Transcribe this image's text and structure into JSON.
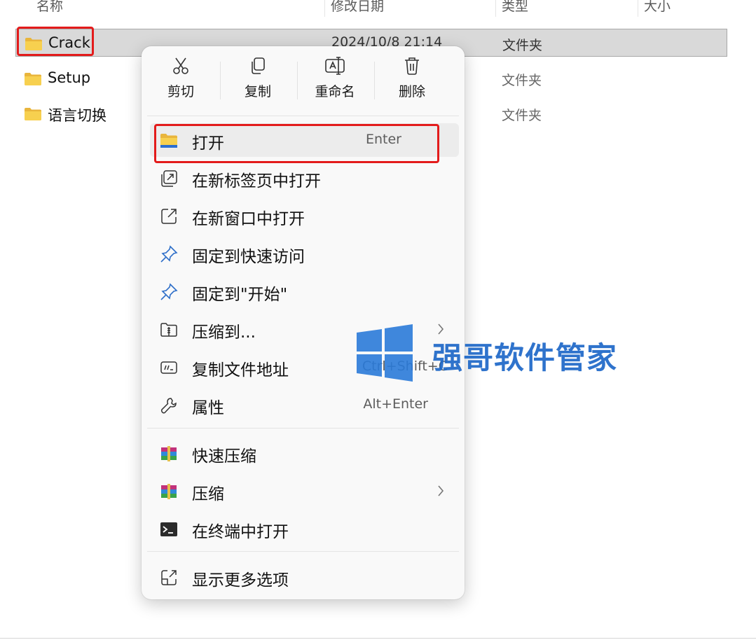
{
  "columns": {
    "name": "名称",
    "modified": "修改日期",
    "type": "类型",
    "size": "大小"
  },
  "files": [
    {
      "name": "Crack",
      "modified": "2024/10/8 21:14",
      "type": "文件夹",
      "selected": true
    },
    {
      "name": "Setup",
      "modified": "",
      "type": "文件夹",
      "selected": false
    },
    {
      "name": "语言切换",
      "modified": "",
      "type": "文件夹",
      "selected": false
    }
  ],
  "context_menu": {
    "quick_actions": [
      {
        "label": "剪切",
        "icon": "scissors-icon"
      },
      {
        "label": "复制",
        "icon": "copy-icon"
      },
      {
        "label": "重命名",
        "icon": "rename-icon"
      },
      {
        "label": "删除",
        "icon": "trash-icon"
      }
    ],
    "items": [
      {
        "label": "打开",
        "shortcut": "Enter",
        "icon": "folder-open-icon"
      },
      {
        "label": "在新标签页中打开",
        "shortcut": "",
        "icon": "new-tab-icon"
      },
      {
        "label": "在新窗口中打开",
        "shortcut": "",
        "icon": "new-window-icon"
      },
      {
        "label": "固定到快速访问",
        "shortcut": "",
        "icon": "pin-icon"
      },
      {
        "label": "固定到\"开始\"",
        "shortcut": "",
        "icon": "pin-icon"
      },
      {
        "label": "压缩到...",
        "shortcut": "",
        "icon": "zip-folder-icon",
        "submenu": true
      },
      {
        "label": "复制文件地址",
        "shortcut": "Ctrl+Shift+C",
        "icon": "copy-path-icon"
      },
      {
        "label": "属性",
        "shortcut": "Alt+Enter",
        "icon": "wrench-icon"
      }
    ],
    "extra_items": [
      {
        "label": "快速压缩",
        "icon": "winrar-icon"
      },
      {
        "label": "压缩",
        "icon": "winrar-icon",
        "submenu": true
      },
      {
        "label": "在终端中打开",
        "icon": "terminal-icon"
      }
    ],
    "more_options": {
      "label": "显示更多选项",
      "icon": "more-options-icon"
    }
  },
  "watermark": {
    "text": "强哥软件管家"
  },
  "colors": {
    "highlight_red": "#e31b1b",
    "watermark_blue": "#1e68c8",
    "folder_yellow": "#f2c94c"
  }
}
